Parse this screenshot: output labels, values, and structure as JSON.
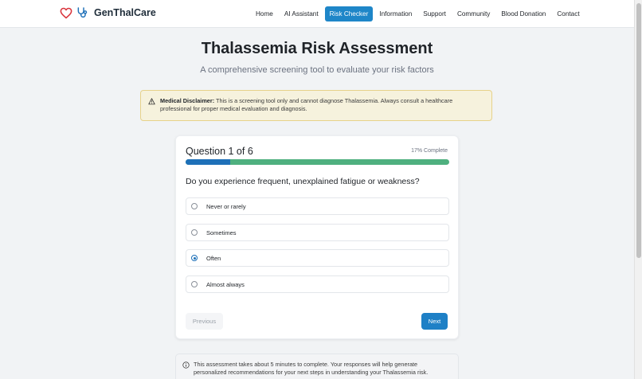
{
  "brand": {
    "name": "GenThalCare"
  },
  "nav": {
    "items": [
      {
        "label": "Home",
        "active": false
      },
      {
        "label": "AI Assistant",
        "active": false
      },
      {
        "label": "Risk Checker",
        "active": true
      },
      {
        "label": "Information",
        "active": false
      },
      {
        "label": "Support",
        "active": false
      },
      {
        "label": "Community",
        "active": false
      },
      {
        "label": "Blood Donation",
        "active": false
      },
      {
        "label": "Contact",
        "active": false
      }
    ]
  },
  "header": {
    "title": "Thalassemia Risk Assessment",
    "subtitle": "A comprehensive screening tool to evaluate your risk factors"
  },
  "disclaimer": {
    "label": "Medical Disclaimer:",
    "text": "This is a screening tool only and cannot diagnose Thalassemia. Always consult a healthcare professional for proper medical evaluation and diagnosis."
  },
  "quiz": {
    "counter": "Question 1 of 6",
    "complete": "17% Complete",
    "progress_percent": 17,
    "question": "Do you experience frequent, unexplained fatigue or weakness?",
    "options": [
      {
        "label": "Never or rarely",
        "selected": false
      },
      {
        "label": "Sometimes",
        "selected": false
      },
      {
        "label": "Often",
        "selected": true
      },
      {
        "label": "Almost always",
        "selected": false
      }
    ],
    "previous_label": "Previous",
    "next_label": "Next"
  },
  "info": {
    "text": "This assessment takes about 5 minutes to complete. Your responses will help generate personalized recommendations for your next steps in understanding your Thalassemia risk."
  },
  "colors": {
    "accent": "#1e80c6",
    "brand_red": "#d9363e",
    "progress_track": "#4fb07f",
    "disclaimer_bg": "#f6f2dd"
  },
  "icons": {
    "brand_heart": "heart-icon",
    "brand_stethoscope": "stethoscope-icon",
    "disclaimer": "warning-icon",
    "info": "info-icon"
  }
}
